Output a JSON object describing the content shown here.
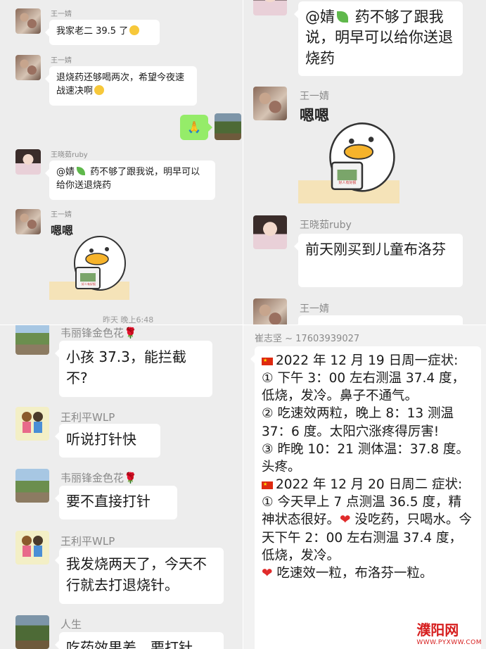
{
  "panel1": {
    "msgs": [
      {
        "name": "王一婧",
        "text": "我家老二 39.5 了"
      },
      {
        "name": "王一婧",
        "text": "退烧药还够喝两次，希望今夜速战速决啊"
      },
      {
        "sent_text": "🙏"
      },
      {
        "name": "王晓茹ruby",
        "text_a": "@婧",
        "text_b": " 药不够了跟我说，明早可以给你送退烧药"
      },
      {
        "name": "王一婧",
        "sticker_text": "嗯嗯",
        "cup_text": "好人有好报"
      }
    ],
    "timestamp": "昨天 晚上6:48"
  },
  "panel2": {
    "top_text_a": "@婧",
    "top_text_b": " 药不够了跟我说，明早可以给你送退烧药",
    "msgs": [
      {
        "name": "王一婧",
        "sticker_text": "嗯嗯",
        "cup_text": "好人有好报"
      },
      {
        "name": "王晓茹ruby",
        "text": "前天刚买到儿童布洛芬"
      },
      {
        "name": "王一婧"
      }
    ]
  },
  "panel3": {
    "msgs": [
      {
        "name": "韦丽锋金色花",
        "text": "小孩 37.3，能拦截不?"
      },
      {
        "name": "王利平WLP",
        "text": "听说打针快"
      },
      {
        "name": "韦丽锋金色花",
        "text": "要不直接打针"
      },
      {
        "name": "王利平WLP",
        "text": "我发烧两天了，今天不行就去打退烧针。"
      },
      {
        "name": "人生",
        "text": "吃药效果差，要打针"
      }
    ]
  },
  "panel4": {
    "name": "崔志坚 ~ 17603939027",
    "lines": [
      "2022 年 12 月 19 日周一症状:",
      "① 下午 3：00 左右测温 37.4 度，低烧，发冷。鼻子不通气。",
      "② 吃速效两粒，晚上 8：13 测温 37：6 度。太阳穴涨疼得厉害!",
      "③ 昨晚 10：21 测体温：37.8 度。头疼。",
      "2022 年 12 月 20 日周二 症状:",
      "① 今天早上 7 点测温 36.5 度，精神状态很好。",
      " 没吃药，只喝水。今天下午 2：00 左右测温 37.4 度，低烧，发冷。",
      " 吃速效一粒，布洛芬一粒。"
    ]
  },
  "watermark": {
    "main": "濮阳网",
    "sub": "WWW.PYXWW.COM"
  },
  "colors": {
    "panel_bg": "#ededed",
    "bubble": "#ffffff",
    "sent_bubble": "#95ec69",
    "name": "#8a8a8a"
  }
}
